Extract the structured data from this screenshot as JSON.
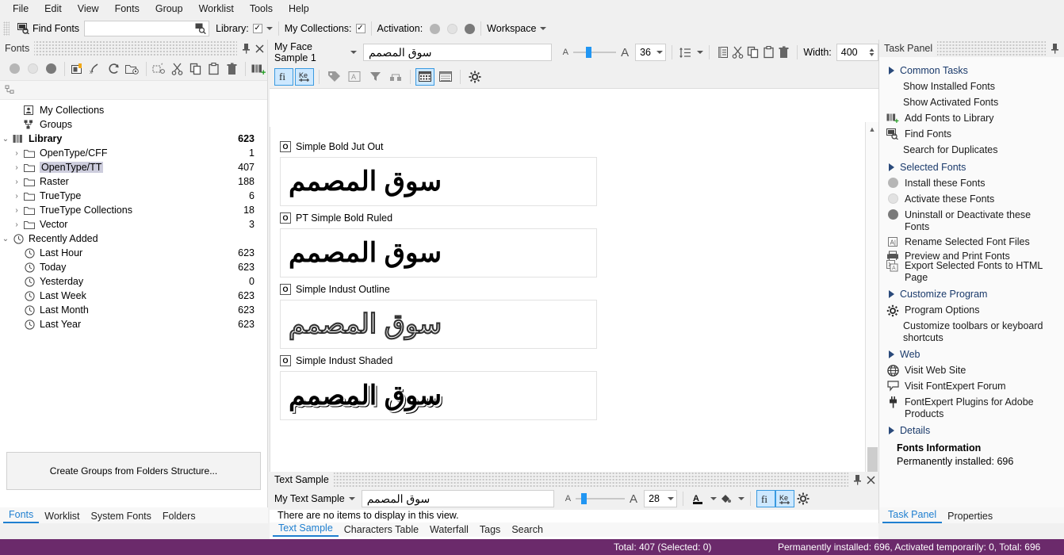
{
  "menu": {
    "items": [
      "File",
      "Edit",
      "View",
      "Fonts",
      "Group",
      "Worklist",
      "Tools",
      "Help"
    ]
  },
  "toolbar": {
    "find_fonts_label": "Find Fonts",
    "find_input_value": "",
    "find_input_placeholder": "",
    "library_label": "Library:",
    "library_checked": "✓",
    "my_collections_label": "My Collections:",
    "my_collections_checked": "✓",
    "activation_label": "Activation:",
    "workspace_label": "Workspace"
  },
  "fonts_panel": {
    "caption": "Fonts",
    "pin_icon": "¤",
    "close_icon": "✕",
    "tree": [
      {
        "label": "My Collections",
        "count": "",
        "indent": 1,
        "expander": "",
        "icon": "collections-icon",
        "bold": false,
        "selected": false
      },
      {
        "label": "Groups",
        "count": "",
        "indent": 1,
        "expander": "",
        "icon": "groups-icon",
        "bold": false,
        "selected": false
      },
      {
        "label": "Library",
        "count": "623",
        "indent": 0,
        "expander": "⌄",
        "icon": "library-icon",
        "bold": true,
        "selected": false
      },
      {
        "label": "OpenType/CFF",
        "count": "1",
        "indent": 2,
        "expander": "›",
        "icon": "folder-icon",
        "bold": false,
        "selected": false
      },
      {
        "label": "OpenType/TT",
        "count": "407",
        "indent": 2,
        "expander": "›",
        "icon": "folder-icon",
        "bold": false,
        "selected": true
      },
      {
        "label": "Raster",
        "count": "188",
        "indent": 2,
        "expander": "›",
        "icon": "folder-icon",
        "bold": false,
        "selected": false
      },
      {
        "label": "TrueType",
        "count": "6",
        "indent": 2,
        "expander": "›",
        "icon": "folder-icon",
        "bold": false,
        "selected": false
      },
      {
        "label": "TrueType Collections",
        "count": "18",
        "indent": 2,
        "expander": "›",
        "icon": "folder-icon",
        "bold": false,
        "selected": false
      },
      {
        "label": "Vector",
        "count": "3",
        "indent": 2,
        "expander": "›",
        "icon": "folder-icon",
        "bold": false,
        "selected": false
      },
      {
        "label": "Recently Added",
        "count": "",
        "indent": 0,
        "expander": "⌄",
        "icon": "clock-icon",
        "bold": false,
        "selected": false
      },
      {
        "label": "Last Hour",
        "count": "623",
        "indent": 2,
        "expander": "",
        "icon": "clock-icon",
        "bold": false,
        "selected": false
      },
      {
        "label": "Today",
        "count": "623",
        "indent": 2,
        "expander": "",
        "icon": "clock-icon",
        "bold": false,
        "selected": false
      },
      {
        "label": "Yesterday",
        "count": "0",
        "indent": 2,
        "expander": "",
        "icon": "clock-icon",
        "bold": false,
        "selected": false
      },
      {
        "label": "Last Week",
        "count": "623",
        "indent": 2,
        "expander": "",
        "icon": "clock-icon",
        "bold": false,
        "selected": false
      },
      {
        "label": "Last Month",
        "count": "623",
        "indent": 2,
        "expander": "",
        "icon": "clock-icon",
        "bold": false,
        "selected": false
      },
      {
        "label": "Last Year",
        "count": "623",
        "indent": 2,
        "expander": "",
        "icon": "clock-icon",
        "bold": false,
        "selected": false
      }
    ],
    "create_groups_button": "Create Groups from Folders Structure...",
    "bottom_tabs": [
      {
        "label": "Fonts",
        "active": true
      },
      {
        "label": "Worklist",
        "active": false
      },
      {
        "label": "System Fonts",
        "active": false
      },
      {
        "label": "Folders",
        "active": false
      }
    ]
  },
  "face_bar": {
    "sample_preset": "My Face Sample 1",
    "sample_text": "سوق المصمم",
    "size_value": "36",
    "width_label": "Width:",
    "width_value": "400",
    "small_a": "A",
    "large_a": "A"
  },
  "font_list": [
    {
      "format": "O",
      "name": "Simple Bold Jut Out",
      "sample": "سوق المصمم",
      "style": "bold"
    },
    {
      "format": "O",
      "name": "PT Simple Bold Ruled",
      "sample": "سوق المصمم",
      "style": "bold"
    },
    {
      "format": "O",
      "name": "Simple Indust Outline",
      "sample": "سوق المصمم",
      "style": "outline"
    },
    {
      "format": "O",
      "name": "Simple Indust Shaded",
      "sample": "سوق المصمم",
      "style": "shaded"
    }
  ],
  "text_sample_panel": {
    "caption": "Text Sample",
    "preset": "My Text Sample",
    "text_value": "سوق المصمم",
    "size_value": "28",
    "small_a": "A",
    "large_a": "A",
    "empty_message": "There are no items to display in this view.",
    "tabs": [
      {
        "label": "Text Sample",
        "active": true
      },
      {
        "label": "Characters Table",
        "active": false
      },
      {
        "label": "Waterfall",
        "active": false
      },
      {
        "label": "Tags",
        "active": false
      },
      {
        "label": "Search",
        "active": false
      }
    ]
  },
  "task_panel": {
    "caption": "Task Panel",
    "sections": [
      {
        "title": "Common Tasks",
        "items": [
          {
            "label": "Show Installed Fonts",
            "icon": ""
          },
          {
            "label": "Show Activated Fonts",
            "icon": ""
          },
          {
            "label": "Add Fonts to Library",
            "icon": "add-fonts-icon"
          },
          {
            "label": "Find Fonts",
            "icon": "find-fonts-icon"
          },
          {
            "label": "Search for Duplicates",
            "icon": ""
          }
        ]
      },
      {
        "title": "Selected Fonts",
        "items": [
          {
            "label": "Install these Fonts",
            "icon": "dot-gray-icon"
          },
          {
            "label": "Activate these Fonts",
            "icon": "dot-light-icon"
          },
          {
            "label": "Uninstall or Deactivate these Fonts",
            "icon": "dot-dark-icon"
          },
          {
            "label": "Rename Selected Font Files",
            "icon": "rename-icon"
          },
          {
            "label": "Preview and Print Fonts",
            "icon": "printer-icon"
          },
          {
            "label": "Export Selected Fonts to HTML Page",
            "icon": "export-html-icon"
          }
        ]
      },
      {
        "title": "Customize Program",
        "items": [
          {
            "label": "Program Options",
            "icon": "gear-icon"
          },
          {
            "label": "Customize toolbars or keyboard shortcuts",
            "icon": ""
          }
        ]
      },
      {
        "title": "Web",
        "items": [
          {
            "label": "Visit Web Site",
            "icon": "globe-icon"
          },
          {
            "label": "Visit FontExpert Forum",
            "icon": "forum-icon"
          },
          {
            "label": "FontExpert Plugins for Adobe Products",
            "icon": "plugin-icon"
          }
        ]
      }
    ],
    "details": {
      "title": "Details",
      "heading": "Fonts Information",
      "line": "Permanently installed: 696"
    },
    "tabs": [
      {
        "label": "Task Panel",
        "active": true
      },
      {
        "label": "Properties",
        "active": false
      }
    ]
  },
  "status_bar": {
    "left": "Total: 407 (Selected: 0)",
    "right": "Permanently installed: 696, Activated temporarily: 0, Total: 696",
    "background": "#6b2a6b"
  }
}
